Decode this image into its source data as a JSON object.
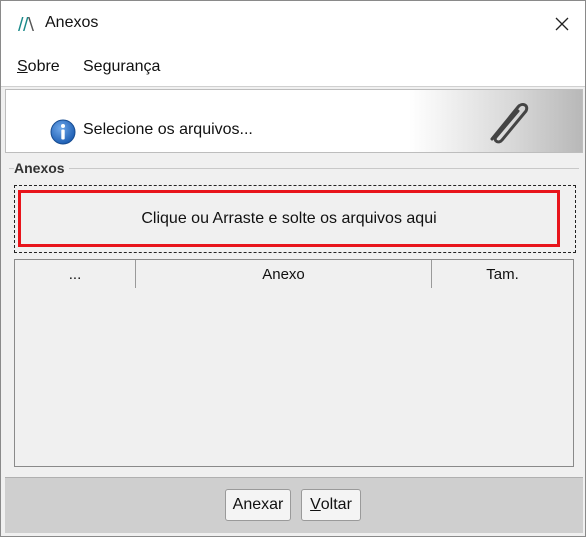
{
  "window": {
    "title": "Anexos",
    "close_symbol": "✕"
  },
  "menu": {
    "items": [
      {
        "accel": "S",
        "rest": "obre"
      },
      {
        "accel": "",
        "rest": "Segurança"
      }
    ]
  },
  "banner": {
    "text": "Selecione os arquivos..."
  },
  "group": {
    "label": "Anexos"
  },
  "dropzone": {
    "text": "Clique ou Arraste e solte os arquivos aqui"
  },
  "table": {
    "columns": [
      "...",
      "Anexo",
      "Tam."
    ],
    "rows": []
  },
  "footer": {
    "anexar_label": "Anexar",
    "voltar_accel": "V",
    "voltar_rest": "oltar"
  },
  "colors": {
    "dropzone_border": "#e8141b",
    "info_blue": "#1e5fb4",
    "app_icon": "#1a8a8a"
  },
  "icons": {
    "app": "app-logo-icon",
    "close": "close-icon",
    "info": "info-icon",
    "attach": "paperclip-icon"
  }
}
